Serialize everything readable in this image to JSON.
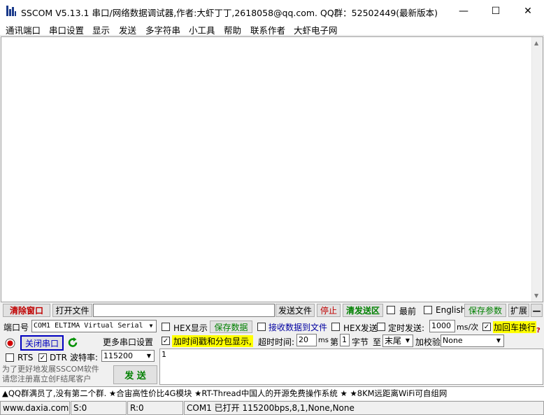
{
  "window": {
    "title": "SSCOM V5.13.1 串口/网络数据调试器,作者:大虾丁丁,2618058@qq.com. QQ群：52502449(最新版本)",
    "minimize": "—",
    "maximize": "☐",
    "close": "✕"
  },
  "menu": [
    "通讯端口",
    "串口设置",
    "显示",
    "发送",
    "多字符串",
    "小工具",
    "帮助",
    "联系作者",
    "大虾电子网"
  ],
  "toolbar": {
    "clear_window": "清除窗口",
    "open_file": "打开文件",
    "file_path": "",
    "send_file": "发送文件",
    "stop": "停止",
    "clear_send": "清发送区",
    "topmost": "最前",
    "english": "English",
    "save_params": "保存参数",
    "expand": "扩展",
    "collapse": "—"
  },
  "port": {
    "label": "端口号",
    "value": "COM1 ELTIMA Virtual Serial",
    "close_port": "关闭串口",
    "more_settings": "更多串口设置",
    "rts": "RTS",
    "dtr": "DTR",
    "baud_label": "波特率:",
    "baud_value": "115200"
  },
  "options": {
    "hex_display": "HEX显示",
    "save_data": "保存数据",
    "recv_to_file": "接收数据到文件",
    "hex_send": "HEX发送",
    "timed_send": "定时发送:",
    "interval": "1000",
    "interval_unit": "ms/次",
    "add_crlf": "加回车换行",
    "timestamp": "加时间戳和分包显示,",
    "timeout_label": "超时时间:",
    "timeout": "20",
    "timeout_unit": "ms",
    "nth_label": "第",
    "nth": "1",
    "byte_label": "字节",
    "to_label": "至",
    "tail": "末尾",
    "checksum_label": "加校验",
    "checksum": "None",
    "help": "?"
  },
  "send": {
    "text": "1",
    "button": "发 送",
    "promo": "为了更好地发展SSCOM软件\n请您注册嘉立创F结尾客户"
  },
  "ticker": "▲QQ群满员了,没有第二个群. ★合宙高性价比4G模块 ★RT-Thread中国人的开源免费操作系统 ★ ★8KM远距离WiFi可自组网",
  "statusbar": {
    "site": "www.daxia.com",
    "sent": "S:0",
    "received": "R:0",
    "port_status": "COM1 已打开  115200bps,8,1,None,None"
  },
  "colors": {
    "accent_red": "#c00000",
    "accent_green": "#008000",
    "highlight": "#ffff00"
  }
}
